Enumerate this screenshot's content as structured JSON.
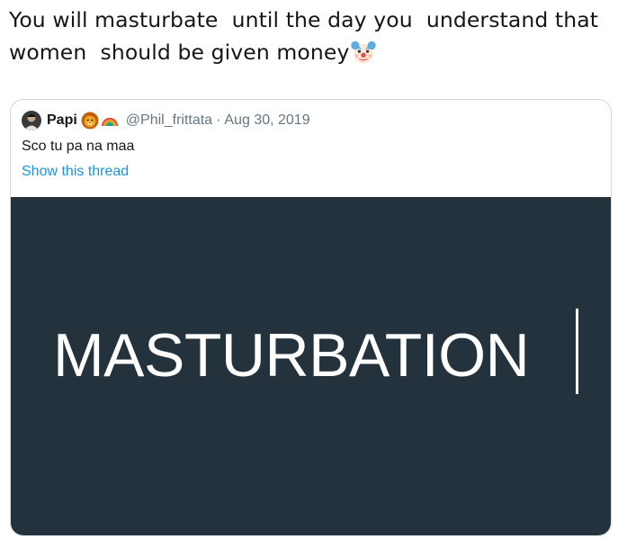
{
  "tweet": {
    "text": "You will masturbate  until the day you  understand that women  should be given money",
    "emoji": "clown-face-emoji"
  },
  "quote": {
    "display_name": "Papi",
    "badges": [
      "lion-face-emoji",
      "rainbow-emoji"
    ],
    "handle": "@Phil_frittata",
    "separator": "·",
    "date": "Aug 30, 2019",
    "body": "Sco tu pa na maa",
    "show_thread": "Show this thread",
    "media": {
      "word": "MASTURBATION",
      "background": "#24323d"
    }
  },
  "colors": {
    "text": "#14171a",
    "secondary": "#657786",
    "link": "#1b95e0",
    "border": "#cfd9de"
  }
}
